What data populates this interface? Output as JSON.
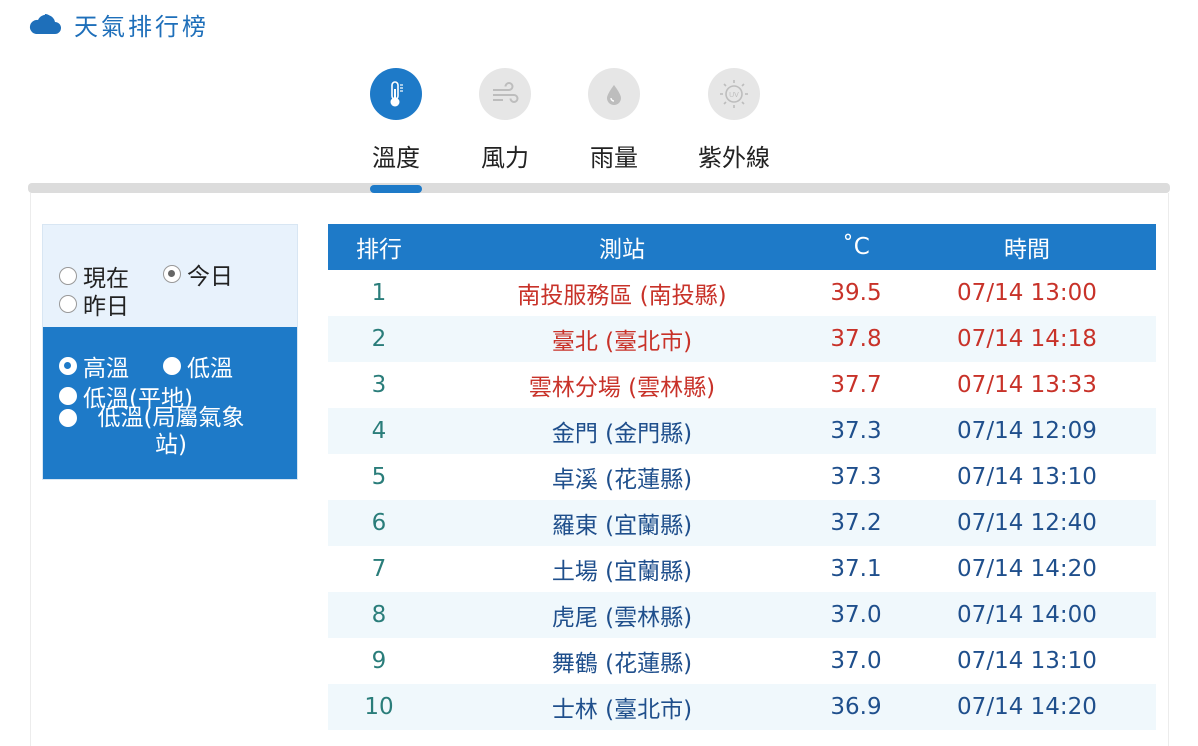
{
  "header": {
    "title": "天氣排行榜",
    "icon": "cloud-icon"
  },
  "tabs": [
    {
      "label": "溫度",
      "icon": "thermometer-icon",
      "active": true
    },
    {
      "label": "風力",
      "icon": "wind-icon",
      "active": false
    },
    {
      "label": "雨量",
      "icon": "raindrop-icon",
      "active": false
    },
    {
      "label": "紫外線",
      "icon": "uv-sun-icon",
      "active": false
    }
  ],
  "filters": {
    "period": {
      "now": "現在",
      "today": "今日",
      "yesterday": "昨日",
      "selected": "今日"
    },
    "type": {
      "high": "高溫",
      "low": "低溫",
      "low_plain": "低溫(平地)",
      "low_station": "低溫(局屬氣象站)",
      "selected": "高溫"
    }
  },
  "table": {
    "headers": {
      "rank": "排行",
      "station": "測站",
      "temp": "˚C",
      "time": "時間"
    },
    "rows": [
      {
        "rank": "1",
        "station": "南投服務區 (南投縣)",
        "temp": "39.5",
        "time": "07/14 13:00",
        "highlight": true
      },
      {
        "rank": "2",
        "station": "臺北 (臺北市)",
        "temp": "37.8",
        "time": "07/14 14:18",
        "highlight": true
      },
      {
        "rank": "3",
        "station": "雲林分場 (雲林縣)",
        "temp": "37.7",
        "time": "07/14 13:33",
        "highlight": true
      },
      {
        "rank": "4",
        "station": "金門 (金門縣)",
        "temp": "37.3",
        "time": "07/14 12:09",
        "highlight": false
      },
      {
        "rank": "5",
        "station": "卓溪 (花蓮縣)",
        "temp": "37.3",
        "time": "07/14 13:10",
        "highlight": false
      },
      {
        "rank": "6",
        "station": "羅東 (宜蘭縣)",
        "temp": "37.2",
        "time": "07/14 12:40",
        "highlight": false
      },
      {
        "rank": "7",
        "station": "土場 (宜蘭縣)",
        "temp": "37.1",
        "time": "07/14 14:20",
        "highlight": false
      },
      {
        "rank": "8",
        "station": "虎尾 (雲林縣)",
        "temp": "37.0",
        "time": "07/14 14:00",
        "highlight": false
      },
      {
        "rank": "9",
        "station": "舞鶴 (花蓮縣)",
        "temp": "37.0",
        "time": "07/14 13:10",
        "highlight": false
      },
      {
        "rank": "10",
        "station": "士林 (臺北市)",
        "temp": "36.9",
        "time": "07/14 14:20",
        "highlight": false
      }
    ]
  },
  "colors": {
    "accent": "#1e7ac8",
    "header_text": "#1e6fba",
    "highlight_text": "#c83229",
    "normal_text": "#1f4f8c",
    "rank_text": "#2a7d7a",
    "stripe": "#f0f8fc"
  }
}
